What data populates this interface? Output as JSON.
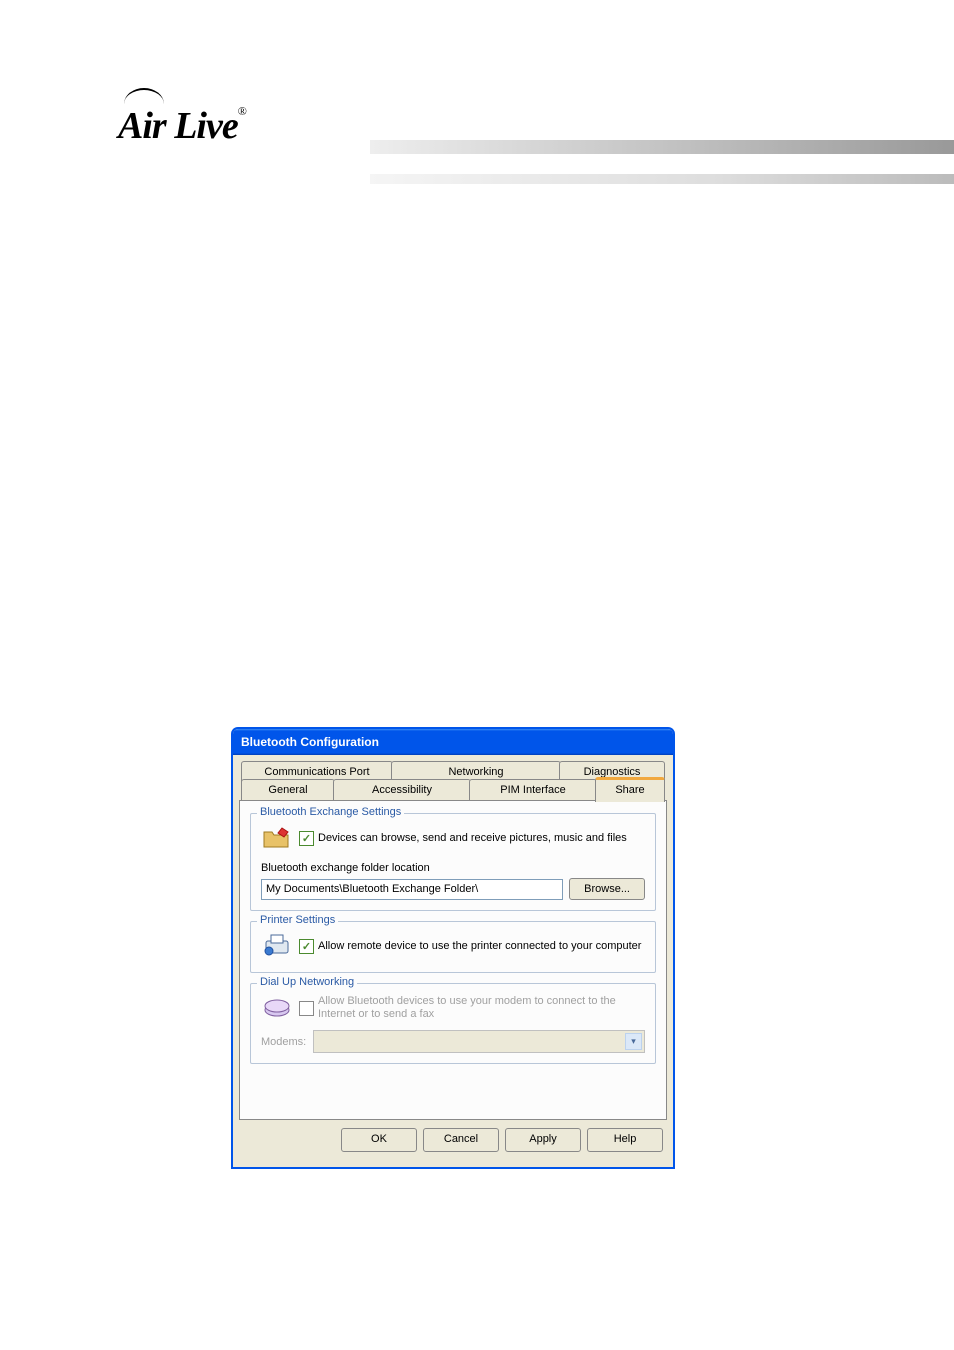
{
  "brand": {
    "name": "Air Live",
    "reg": "®"
  },
  "dialog": {
    "title": "Bluetooth Configuration",
    "tabs_back": [
      {
        "label": "Communications Port"
      },
      {
        "label": "Networking"
      },
      {
        "label": "Diagnostics"
      }
    ],
    "tabs_front": [
      {
        "label": "General"
      },
      {
        "label": "Accessibility"
      },
      {
        "label": "PIM Interface"
      },
      {
        "label": "Share"
      }
    ],
    "sections": {
      "exchange": {
        "legend": "Bluetooth Exchange Settings",
        "chk_label": "Devices can browse, send and receive pictures, music and files",
        "location_label": "Bluetooth exchange folder location",
        "path": "My Documents\\Bluetooth Exchange Folder\\",
        "browse": "Browse..."
      },
      "printer": {
        "legend": "Printer Settings",
        "chk_label": "Allow remote device to use the printer connected to your computer"
      },
      "dialup": {
        "legend": "Dial Up Networking",
        "chk_label": "Allow Bluetooth devices to use your modem to connect to the Internet or to send a fax",
        "modems_label": "Modems:"
      }
    },
    "buttons": {
      "ok": "OK",
      "cancel": "Cancel",
      "apply": "Apply",
      "help": "Help"
    }
  }
}
